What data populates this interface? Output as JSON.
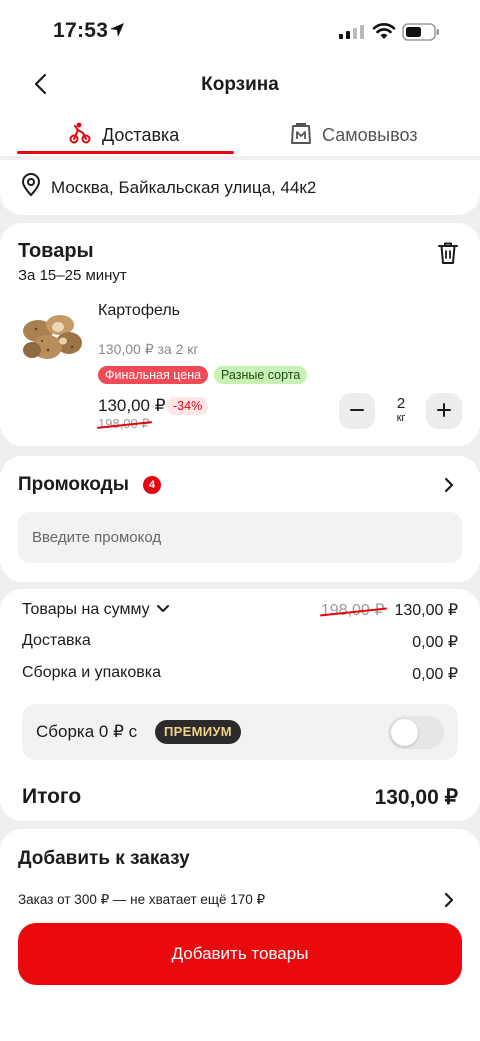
{
  "status_bar": {
    "time": "17:53",
    "icons": [
      "location-arrow-icon",
      "signal-icon",
      "wifi-icon",
      "battery-icon"
    ]
  },
  "header": {
    "title": "Корзина",
    "back_icon": "chevron-left-icon"
  },
  "tabs": [
    {
      "label": "Доставка",
      "icon": "courier-icon",
      "active": true
    },
    {
      "label": "Самовывоз",
      "icon": "shopping-bag-icon",
      "active": false
    }
  ],
  "address": {
    "text": "Москва, Байкальская улица, 44к2",
    "icon": "map-pin-icon"
  },
  "goods": {
    "title": "Товары",
    "eta": "За 15–25 минут",
    "item": {
      "name": "Картофель",
      "unit_price": "130,00 ₽ за 2 кг",
      "badges": [
        "Финальная цена",
        "Разные сорта"
      ],
      "price": "130,00 ₽",
      "discount": "-34%",
      "old_price": "198,00 ₽",
      "quantity": "2",
      "quantity_unit": "кг"
    }
  },
  "promo": {
    "title": "Промокоды",
    "count": "4",
    "placeholder": "Введите промокод"
  },
  "summary": {
    "goods_label": "Товары на сумму",
    "goods_old": "198,00 ₽",
    "goods_value": "130,00 ₽",
    "delivery_label": "Доставка",
    "delivery_value": "0,00 ₽",
    "packing_label": "Сборка и упаковка",
    "packing_value": "0,00 ₽",
    "premium_text": "Сборка 0 ₽ с",
    "premium_badge": "ПРЕМИУМ",
    "premium_enabled": false,
    "total_label": "Итого",
    "total_value": "130,00 ₽"
  },
  "add_to_order": {
    "title": "Добавить к заказу",
    "note": "Заказ от 300 ₽ — не хватает ещё 170 ₽",
    "button": "Добавить товары"
  },
  "colors": {
    "accent": "#E30611",
    "background": "#EFEFEF",
    "card": "#FFFFFF",
    "premium_badge_bg": "#2B2B2B"
  }
}
